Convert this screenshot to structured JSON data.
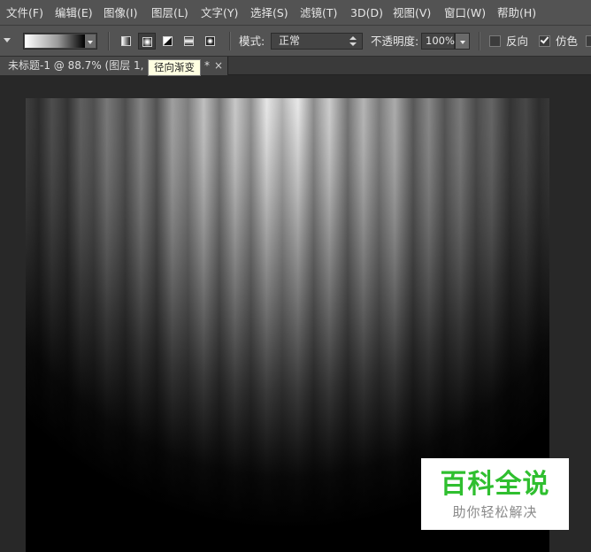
{
  "menu": {
    "items": [
      {
        "label": "文件(F)"
      },
      {
        "label": "编辑(E)"
      },
      {
        "label": "图像(I)"
      },
      {
        "label": "图层(L)"
      },
      {
        "label": "文字(Y)"
      },
      {
        "label": "选择(S)"
      },
      {
        "label": "滤镜(T)"
      },
      {
        "label": "3D(D)"
      },
      {
        "label": "视图(V)"
      },
      {
        "label": "窗口(W)"
      },
      {
        "label": "帮助(H)"
      }
    ]
  },
  "options": {
    "gradient_preview": {
      "from": "#ffffff",
      "to": "#000000"
    },
    "gradient_types": [
      {
        "name": "linear-gradient-icon",
        "active": false
      },
      {
        "name": "radial-gradient-icon",
        "active": true
      },
      {
        "name": "angle-gradient-icon",
        "active": false
      },
      {
        "name": "reflected-gradient-icon",
        "active": false
      },
      {
        "name": "diamond-gradient-icon",
        "active": false
      }
    ],
    "mode_label": "模式:",
    "mode_value": "正常",
    "opacity_label": "不透明度:",
    "opacity_value": "100%",
    "reverse_label": "反向",
    "reverse_checked": false,
    "dither_label": "仿色",
    "dither_checked": true
  },
  "document": {
    "tab_title": "未标题-1 @ 88.7% (图层 1, 图",
    "tab_suffix": "*",
    "close_glyph": "×"
  },
  "tooltip": {
    "text": "径向渐变"
  },
  "watermark": {
    "title": "百科全说",
    "subtitle": "助你轻松解决",
    "title_color": "#2fbf2f"
  }
}
